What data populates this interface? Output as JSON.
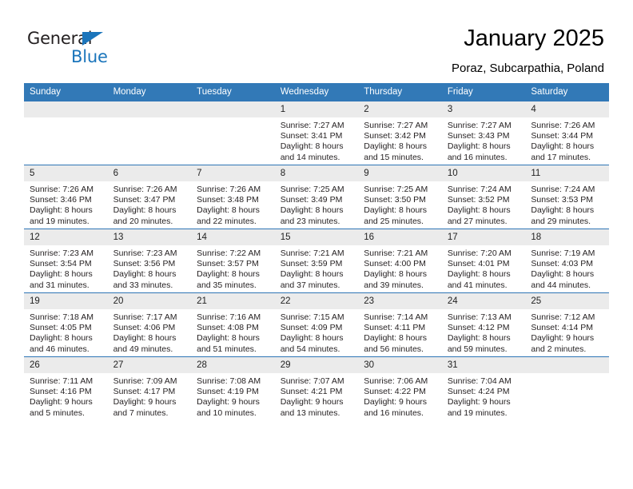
{
  "brand": {
    "name_top": "General",
    "name_bottom": "Blue",
    "triangle_color": "#1b75bb",
    "text_color": "#231f20"
  },
  "header": {
    "title": "January 2025",
    "subtitle": "Poraz, Subcarpathia, Poland"
  },
  "colors": {
    "header_blue": "#3279b7",
    "row_divider_blue": "#2e75b6",
    "daynum_band": "#ebebeb",
    "page_background": "#ffffff"
  },
  "calendar": {
    "weekday_headers": [
      "Sunday",
      "Monday",
      "Tuesday",
      "Wednesday",
      "Thursday",
      "Friday",
      "Saturday"
    ],
    "labels": {
      "sunrise": "Sunrise:",
      "sunset": "Sunset:",
      "daylight": "Daylight:"
    },
    "weeks": [
      [
        {
          "day": "",
          "sunrise": "",
          "sunset": "",
          "daylight_1": "",
          "daylight_2": ""
        },
        {
          "day": "",
          "sunrise": "",
          "sunset": "",
          "daylight_1": "",
          "daylight_2": ""
        },
        {
          "day": "",
          "sunrise": "",
          "sunset": "",
          "daylight_1": "",
          "daylight_2": ""
        },
        {
          "day": "1",
          "sunrise": "Sunrise: 7:27 AM",
          "sunset": "Sunset: 3:41 PM",
          "daylight_1": "Daylight: 8 hours",
          "daylight_2": "and 14 minutes."
        },
        {
          "day": "2",
          "sunrise": "Sunrise: 7:27 AM",
          "sunset": "Sunset: 3:42 PM",
          "daylight_1": "Daylight: 8 hours",
          "daylight_2": "and 15 minutes."
        },
        {
          "day": "3",
          "sunrise": "Sunrise: 7:27 AM",
          "sunset": "Sunset: 3:43 PM",
          "daylight_1": "Daylight: 8 hours",
          "daylight_2": "and 16 minutes."
        },
        {
          "day": "4",
          "sunrise": "Sunrise: 7:26 AM",
          "sunset": "Sunset: 3:44 PM",
          "daylight_1": "Daylight: 8 hours",
          "daylight_2": "and 17 minutes."
        }
      ],
      [
        {
          "day": "5",
          "sunrise": "Sunrise: 7:26 AM",
          "sunset": "Sunset: 3:46 PM",
          "daylight_1": "Daylight: 8 hours",
          "daylight_2": "and 19 minutes."
        },
        {
          "day": "6",
          "sunrise": "Sunrise: 7:26 AM",
          "sunset": "Sunset: 3:47 PM",
          "daylight_1": "Daylight: 8 hours",
          "daylight_2": "and 20 minutes."
        },
        {
          "day": "7",
          "sunrise": "Sunrise: 7:26 AM",
          "sunset": "Sunset: 3:48 PM",
          "daylight_1": "Daylight: 8 hours",
          "daylight_2": "and 22 minutes."
        },
        {
          "day": "8",
          "sunrise": "Sunrise: 7:25 AM",
          "sunset": "Sunset: 3:49 PM",
          "daylight_1": "Daylight: 8 hours",
          "daylight_2": "and 23 minutes."
        },
        {
          "day": "9",
          "sunrise": "Sunrise: 7:25 AM",
          "sunset": "Sunset: 3:50 PM",
          "daylight_1": "Daylight: 8 hours",
          "daylight_2": "and 25 minutes."
        },
        {
          "day": "10",
          "sunrise": "Sunrise: 7:24 AM",
          "sunset": "Sunset: 3:52 PM",
          "daylight_1": "Daylight: 8 hours",
          "daylight_2": "and 27 minutes."
        },
        {
          "day": "11",
          "sunrise": "Sunrise: 7:24 AM",
          "sunset": "Sunset: 3:53 PM",
          "daylight_1": "Daylight: 8 hours",
          "daylight_2": "and 29 minutes."
        }
      ],
      [
        {
          "day": "12",
          "sunrise": "Sunrise: 7:23 AM",
          "sunset": "Sunset: 3:54 PM",
          "daylight_1": "Daylight: 8 hours",
          "daylight_2": "and 31 minutes."
        },
        {
          "day": "13",
          "sunrise": "Sunrise: 7:23 AM",
          "sunset": "Sunset: 3:56 PM",
          "daylight_1": "Daylight: 8 hours",
          "daylight_2": "and 33 minutes."
        },
        {
          "day": "14",
          "sunrise": "Sunrise: 7:22 AM",
          "sunset": "Sunset: 3:57 PM",
          "daylight_1": "Daylight: 8 hours",
          "daylight_2": "and 35 minutes."
        },
        {
          "day": "15",
          "sunrise": "Sunrise: 7:21 AM",
          "sunset": "Sunset: 3:59 PM",
          "daylight_1": "Daylight: 8 hours",
          "daylight_2": "and 37 minutes."
        },
        {
          "day": "16",
          "sunrise": "Sunrise: 7:21 AM",
          "sunset": "Sunset: 4:00 PM",
          "daylight_1": "Daylight: 8 hours",
          "daylight_2": "and 39 minutes."
        },
        {
          "day": "17",
          "sunrise": "Sunrise: 7:20 AM",
          "sunset": "Sunset: 4:01 PM",
          "daylight_1": "Daylight: 8 hours",
          "daylight_2": "and 41 minutes."
        },
        {
          "day": "18",
          "sunrise": "Sunrise: 7:19 AM",
          "sunset": "Sunset: 4:03 PM",
          "daylight_1": "Daylight: 8 hours",
          "daylight_2": "and 44 minutes."
        }
      ],
      [
        {
          "day": "19",
          "sunrise": "Sunrise: 7:18 AM",
          "sunset": "Sunset: 4:05 PM",
          "daylight_1": "Daylight: 8 hours",
          "daylight_2": "and 46 minutes."
        },
        {
          "day": "20",
          "sunrise": "Sunrise: 7:17 AM",
          "sunset": "Sunset: 4:06 PM",
          "daylight_1": "Daylight: 8 hours",
          "daylight_2": "and 49 minutes."
        },
        {
          "day": "21",
          "sunrise": "Sunrise: 7:16 AM",
          "sunset": "Sunset: 4:08 PM",
          "daylight_1": "Daylight: 8 hours",
          "daylight_2": "and 51 minutes."
        },
        {
          "day": "22",
          "sunrise": "Sunrise: 7:15 AM",
          "sunset": "Sunset: 4:09 PM",
          "daylight_1": "Daylight: 8 hours",
          "daylight_2": "and 54 minutes."
        },
        {
          "day": "23",
          "sunrise": "Sunrise: 7:14 AM",
          "sunset": "Sunset: 4:11 PM",
          "daylight_1": "Daylight: 8 hours",
          "daylight_2": "and 56 minutes."
        },
        {
          "day": "24",
          "sunrise": "Sunrise: 7:13 AM",
          "sunset": "Sunset: 4:12 PM",
          "daylight_1": "Daylight: 8 hours",
          "daylight_2": "and 59 minutes."
        },
        {
          "day": "25",
          "sunrise": "Sunrise: 7:12 AM",
          "sunset": "Sunset: 4:14 PM",
          "daylight_1": "Daylight: 9 hours",
          "daylight_2": "and 2 minutes."
        }
      ],
      [
        {
          "day": "26",
          "sunrise": "Sunrise: 7:11 AM",
          "sunset": "Sunset: 4:16 PM",
          "daylight_1": "Daylight: 9 hours",
          "daylight_2": "and 5 minutes."
        },
        {
          "day": "27",
          "sunrise": "Sunrise: 7:09 AM",
          "sunset": "Sunset: 4:17 PM",
          "daylight_1": "Daylight: 9 hours",
          "daylight_2": "and 7 minutes."
        },
        {
          "day": "28",
          "sunrise": "Sunrise: 7:08 AM",
          "sunset": "Sunset: 4:19 PM",
          "daylight_1": "Daylight: 9 hours",
          "daylight_2": "and 10 minutes."
        },
        {
          "day": "29",
          "sunrise": "Sunrise: 7:07 AM",
          "sunset": "Sunset: 4:21 PM",
          "daylight_1": "Daylight: 9 hours",
          "daylight_2": "and 13 minutes."
        },
        {
          "day": "30",
          "sunrise": "Sunrise: 7:06 AM",
          "sunset": "Sunset: 4:22 PM",
          "daylight_1": "Daylight: 9 hours",
          "daylight_2": "and 16 minutes."
        },
        {
          "day": "31",
          "sunrise": "Sunrise: 7:04 AM",
          "sunset": "Sunset: 4:24 PM",
          "daylight_1": "Daylight: 9 hours",
          "daylight_2": "and 19 minutes."
        },
        {
          "day": "",
          "sunrise": "",
          "sunset": "",
          "daylight_1": "",
          "daylight_2": ""
        }
      ]
    ]
  }
}
